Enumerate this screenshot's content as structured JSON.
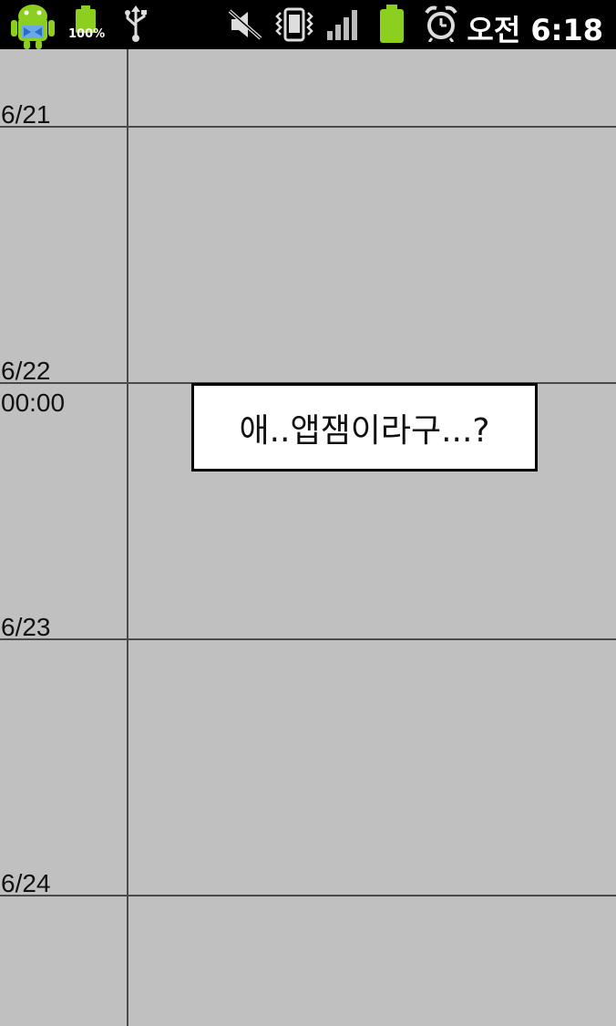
{
  "status_bar": {
    "battery_percent_label": "100%",
    "time": "오전 6:18",
    "icons": [
      "android-debug-icon",
      "battery-full-icon",
      "usb-icon",
      "mute-icon",
      "vibrate-icon",
      "signal-icon",
      "battery-icon",
      "alarm-icon"
    ],
    "battery_color": "#8ccf1e"
  },
  "timeline": {
    "days": [
      {
        "date": "6/21"
      },
      {
        "date": "6/22",
        "time": "00:00"
      },
      {
        "date": "6/23"
      },
      {
        "date": "6/24"
      }
    ],
    "event": {
      "title": "애..앱잼이라구...?"
    }
  }
}
